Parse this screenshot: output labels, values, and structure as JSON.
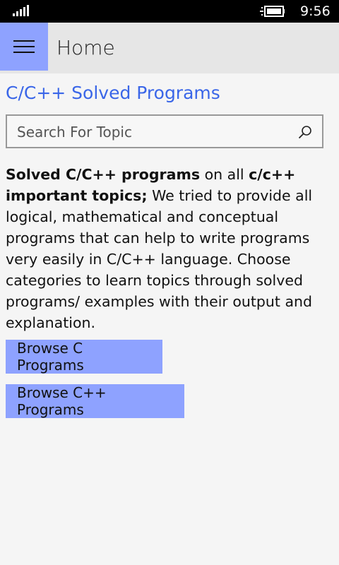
{
  "status_bar": {
    "time": "9:56",
    "signal_icon": "signal-icon",
    "battery_icon": "battery-charging-icon"
  },
  "app_bar": {
    "menu_icon": "hamburger-menu-icon",
    "title": "Home"
  },
  "main": {
    "title": "C/C++ Solved Programs",
    "search": {
      "placeholder": "Search For Topic",
      "value": "",
      "icon": "search-icon"
    },
    "description": {
      "bold1": "Solved C/C++ programs",
      "text1": " on all ",
      "bold2": "c/c++ important topics;",
      "text2": " We tried to provide all logical, mathematical and conceptual programs that can help to write programs very easily in C/C++ language. Choose categories to learn topics through solved programs/ examples with their output and explanation."
    },
    "buttons": {
      "browse_c": "Browse C Programs",
      "browse_cpp": "Browse C++ Programs"
    }
  },
  "colors": {
    "accent": "#8ea2ff",
    "title_blue": "#3a66e8",
    "app_bar_bg": "#e6e6e6",
    "page_bg": "#f5f5f5"
  }
}
